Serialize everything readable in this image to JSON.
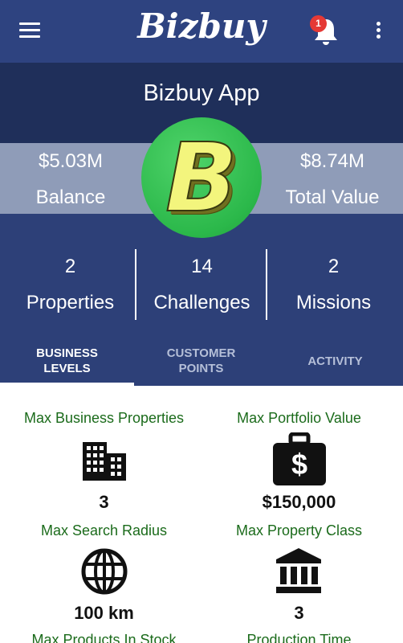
{
  "appbar": {
    "logo_text": "Bizbuy",
    "notification_count": "1",
    "icons": [
      "menu-icon",
      "bell-icon",
      "more-vert-icon"
    ]
  },
  "header": {
    "app_name": "Bizbuy App",
    "balance": {
      "value": "$5.03M",
      "label": "Balance"
    },
    "total_value": {
      "value": "$8.74M",
      "label": "Total Value"
    },
    "logo_letter": "B",
    "counts": [
      {
        "value": "2",
        "label": "Properties"
      },
      {
        "value": "14",
        "label": "Challenges"
      },
      {
        "value": "2",
        "label": "Missions"
      }
    ]
  },
  "tabs": [
    {
      "line1": "BUSINESS",
      "line2": "LEVELS",
      "active": true
    },
    {
      "line1": "CUSTOMER",
      "line2": "POINTS",
      "active": false
    },
    {
      "line1": "ACTIVITY",
      "line2": "",
      "active": false
    }
  ],
  "levels": [
    {
      "title": "Max Business Properties",
      "value": "3",
      "icon": "building-icon"
    },
    {
      "title": "Max Portfolio Value",
      "value": "$150,000",
      "icon": "money-bag-icon"
    },
    {
      "title": "Max Search Radius",
      "value": "100 km",
      "icon": "globe-icon"
    },
    {
      "title": "Max Property Class",
      "value": "3",
      "icon": "bank-icon"
    },
    {
      "title": "Max Products In Stock",
      "value": "",
      "icon": ""
    },
    {
      "title": "Production Time",
      "value": "",
      "icon": ""
    }
  ],
  "colors": {
    "appbar": "#2e4380",
    "header_dark": "#1f2f5a",
    "header": "#2d4078",
    "balance_band": "#8f9cb8",
    "logo_green": "#2bb84a",
    "title_green": "#1b6b1b",
    "badge_red": "#e53935"
  }
}
